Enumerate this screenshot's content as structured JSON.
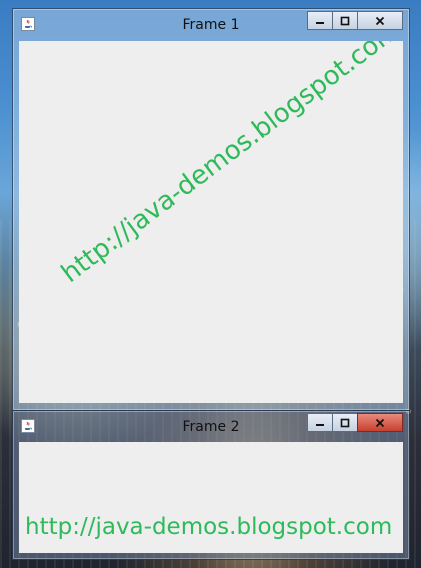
{
  "desktop": {
    "description_icon": "city-night-wallpaper"
  },
  "frame1": {
    "title": "Frame 1",
    "icon": "java-coffee-icon",
    "buttons": {
      "minimize": "minimize-icon",
      "maximize": "maximize-icon",
      "close": "close-icon",
      "close_label": "x"
    },
    "watermark_text": "http://java-demos.blogspot.com"
  },
  "frame2": {
    "title": "Frame 2",
    "icon": "java-coffee-icon",
    "buttons": {
      "minimize": "minimize-icon",
      "maximize": "maximize-icon",
      "close": "close-icon",
      "close_label": "x"
    },
    "watermark_text": "http://java-demos.blogspot.com"
  },
  "colors": {
    "watermark": "#2fba5a",
    "client_bg": "#eeeeee",
    "close_hover": "#c7402f"
  }
}
